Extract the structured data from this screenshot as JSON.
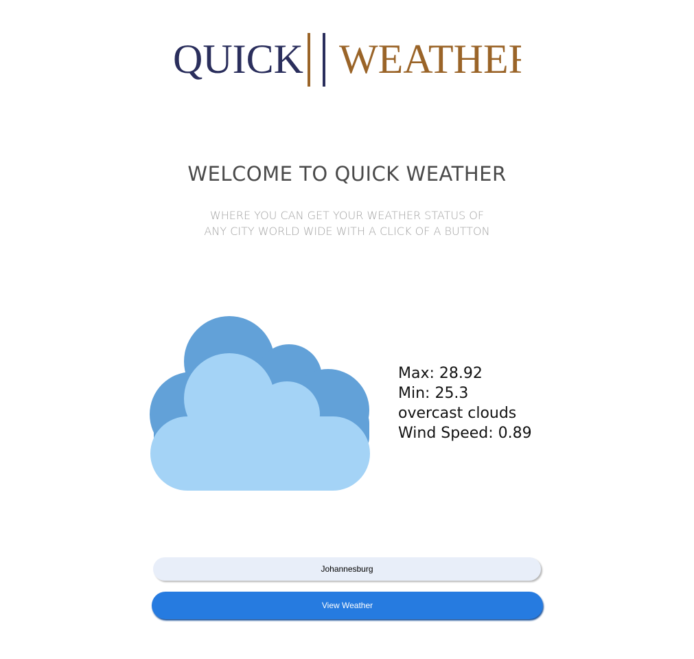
{
  "logo": {
    "word_left": "QUICK",
    "word_right": "WEATHER",
    "colors": {
      "navy": "#2a2e5c",
      "brown": "#9a6428"
    }
  },
  "welcome_title": "WELCOME TO QUICK WEATHER",
  "subtitle": {
    "line1": "WHERE YOU CAN GET YOUR WEATHER STATUS OF",
    "line2": "ANY CITY WORLD WIDE WITH A CLICK OF A BUTTON"
  },
  "weather": {
    "icon": "cloud-icon",
    "max": "Max: 28.92",
    "min": "Min: 25.3",
    "description": "overcast clouds",
    "wind": "Wind Speed: 0.89",
    "colors": {
      "cloud_back": "#62a1d8",
      "cloud_front": "#a4d3f6"
    }
  },
  "search": {
    "value": "Johannesburg",
    "button_label": "View Weather",
    "colors": {
      "input_bg": "#e8eef9",
      "button_bg": "#267be0"
    }
  }
}
